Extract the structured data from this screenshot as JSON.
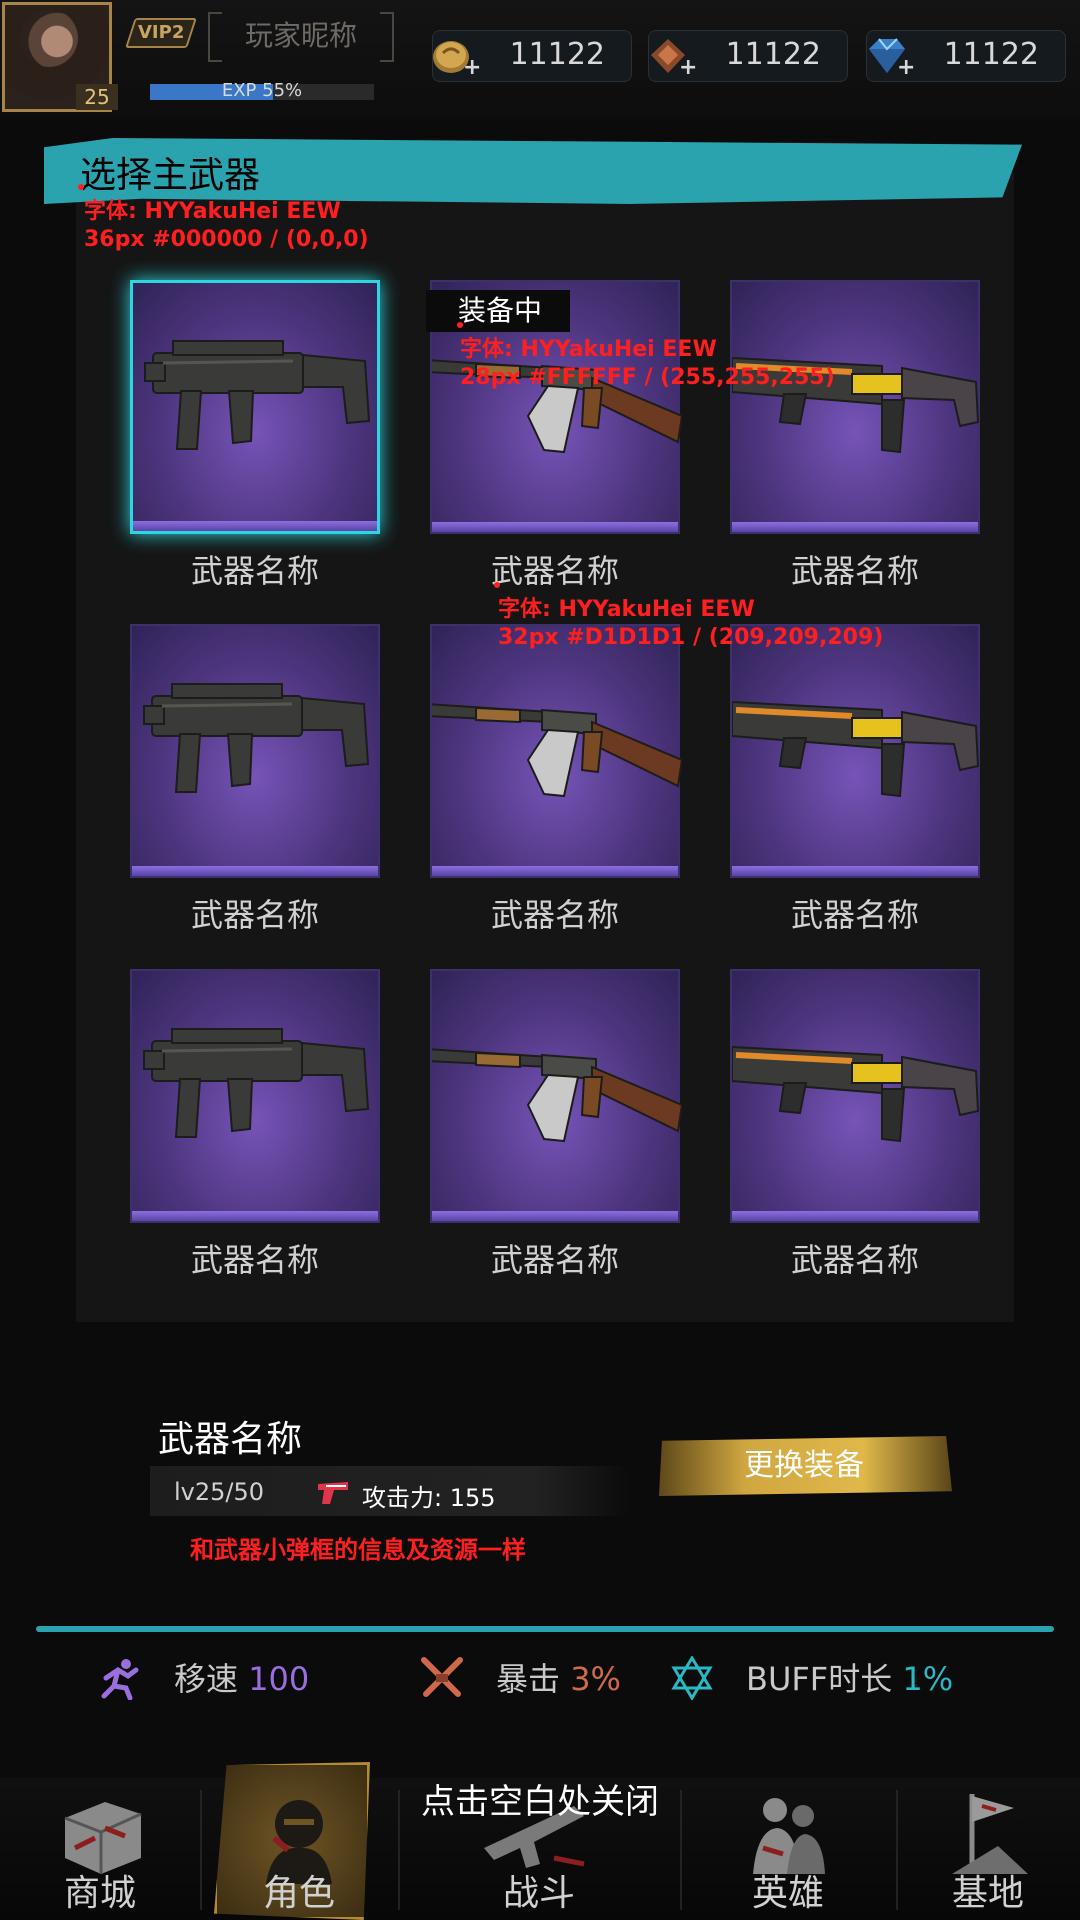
{
  "header": {
    "avatar_level": "25",
    "vip_label": "VIP2",
    "nickname": "玩家昵称",
    "exp_text": "EXP 55%",
    "exp_progress": 0.55,
    "currencies": [
      {
        "icon": "gold-coin-icon",
        "value": "11122"
      },
      {
        "icon": "badge-icon",
        "value": "11122"
      },
      {
        "icon": "diamond-icon",
        "value": "11122"
      }
    ]
  },
  "panel": {
    "title": "选择主武器",
    "equipped_tag": "装备中",
    "weapons": [
      {
        "name": "武器名称",
        "icon": "smg-icon",
        "selected": true
      },
      {
        "name": "武器名称",
        "icon": "rifle-icon",
        "equipped": true
      },
      {
        "name": "武器名称",
        "icon": "energy-gun-icon"
      },
      {
        "name": "武器名称",
        "icon": "smg-icon"
      },
      {
        "name": "武器名称",
        "icon": "rifle-icon"
      },
      {
        "name": "武器名称",
        "icon": "energy-gun-icon"
      },
      {
        "name": "武器名称",
        "icon": "smg-icon"
      },
      {
        "name": "武器名称",
        "icon": "rifle-icon"
      },
      {
        "name": "武器名称",
        "icon": "energy-gun-icon"
      }
    ]
  },
  "annotations": {
    "title_font": "字体: HYYakuHei EEW",
    "title_spec": "36px #000000 / (0,0,0)",
    "tag_font": "字体: HYYakuHei EEW",
    "tag_spec": "28px #FFFFFF / (255,255,255)",
    "name_font": "字体: HYYakuHei EEW",
    "name_spec": "32px #D1D1D1 / (209,209,209)"
  },
  "detail": {
    "name": "武器名称",
    "level": "lv25/50",
    "attack": "攻击力: 155",
    "note": "和武器小弹框的信息及资源一样",
    "change_button": "更换装备"
  },
  "stats": [
    {
      "icon": "runner-icon",
      "label": "移速",
      "value": "100",
      "color": "#9b6ee0"
    },
    {
      "icon": "crossed-swords-icon",
      "label": "暴击",
      "value": "3%",
      "color": "#d0694a"
    },
    {
      "icon": "hexagram-icon",
      "label": "BUFF时长",
      "value": "1%",
      "color": "#2ab8c4"
    }
  ],
  "nav": {
    "close_hint": "点击空白处关闭",
    "items": [
      {
        "icon": "shop-icon",
        "label": "商城"
      },
      {
        "icon": "character-icon",
        "label": "角色",
        "active": true
      },
      {
        "icon": "battle-icon",
        "label": "战斗"
      },
      {
        "icon": "heroes-icon",
        "label": "英雄"
      },
      {
        "icon": "base-flag-icon",
        "label": "基地"
      }
    ]
  },
  "colors": {
    "accent_teal": "#2aa3ae",
    "gold": "#d0a640",
    "slot_purple": "#4d357e",
    "annotation_red": "#ff1f1f"
  }
}
